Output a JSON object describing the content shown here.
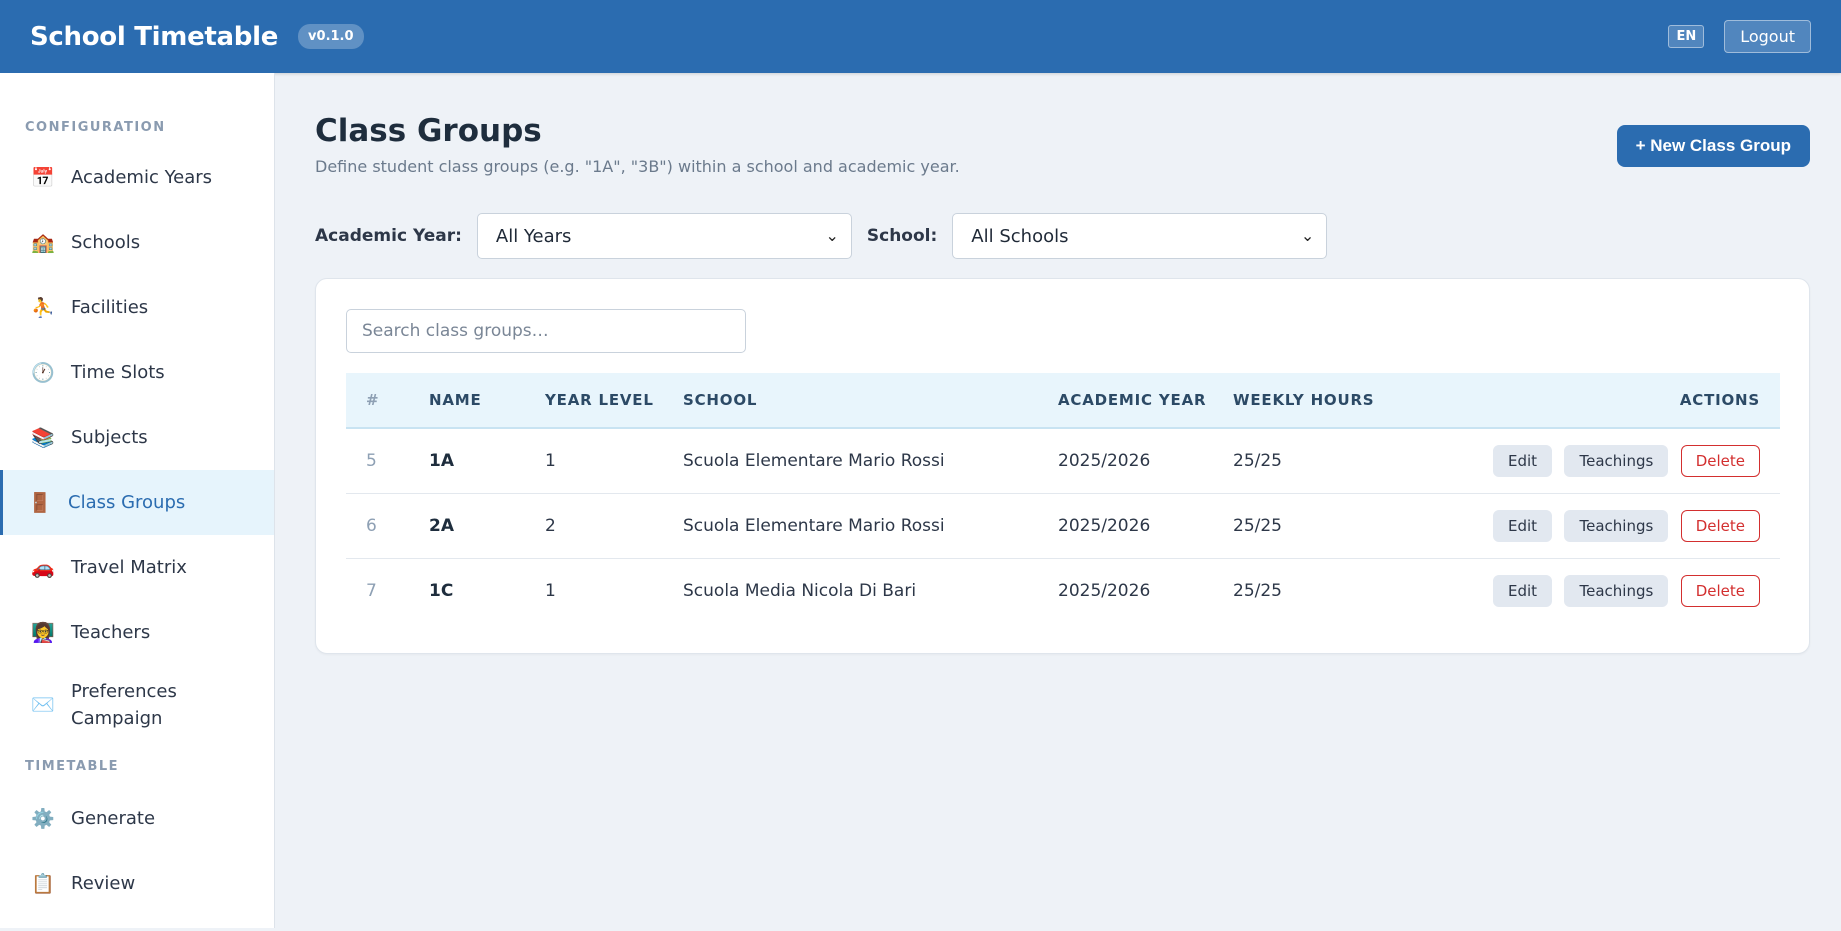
{
  "header": {
    "title": "School Timetable",
    "version": "v0.1.0",
    "language": "EN",
    "logout_label": "Logout"
  },
  "sidebar": {
    "sections": {
      "configuration": "CONFIGURATION",
      "timetable": "TIMETABLE"
    },
    "items": [
      {
        "label": "Academic Years",
        "icon": "📅"
      },
      {
        "label": "Schools",
        "icon": "🏫"
      },
      {
        "label": "Facilities",
        "icon": "⛹"
      },
      {
        "label": "Time Slots",
        "icon": "🕐"
      },
      {
        "label": "Subjects",
        "icon": "📚"
      },
      {
        "label": "Class Groups",
        "icon": "🚪"
      },
      {
        "label": "Travel Matrix",
        "icon": "🚗"
      },
      {
        "label": "Teachers",
        "icon": "👩‍🏫"
      },
      {
        "label": "Preferences Campaign",
        "icon": "✉️"
      },
      {
        "label": "Generate",
        "icon": "⚙️"
      },
      {
        "label": "Review",
        "icon": "📋"
      }
    ],
    "active": "Class Groups"
  },
  "page": {
    "title": "Class Groups",
    "subtitle": "Define student class groups (e.g. \"1A\", \"3B\") within a school and academic year.",
    "new_button": "+ New Class Group"
  },
  "filters": {
    "academic_year_label": "Academic Year:",
    "academic_year_value": "All Years",
    "school_label": "School:",
    "school_value": "All Schools"
  },
  "search": {
    "placeholder": "Search class groups…"
  },
  "table": {
    "columns": [
      "#",
      "NAME",
      "YEAR LEVEL",
      "SCHOOL",
      "ACADEMIC YEAR",
      "WEEKLY HOURS",
      "ACTIONS"
    ],
    "rows": [
      {
        "id": "5",
        "name": "1A",
        "year_level": "1",
        "school": "Scuola Elementare Mario Rossi",
        "academic_year": "2025/2026",
        "weekly_hours": "25/25"
      },
      {
        "id": "6",
        "name": "2A",
        "year_level": "2",
        "school": "Scuola Elementare Mario Rossi",
        "academic_year": "2025/2026",
        "weekly_hours": "25/25"
      },
      {
        "id": "7",
        "name": "1C",
        "year_level": "1",
        "school": "Scuola Media Nicola Di Bari",
        "academic_year": "2025/2026",
        "weekly_hours": "25/25"
      }
    ],
    "actions": {
      "edit": "Edit",
      "teachings": "Teachings",
      "delete": "Delete"
    }
  },
  "colors": {
    "primary": "#2b6cb0",
    "danger": "#d32f2f",
    "background": "#eef2f7"
  }
}
